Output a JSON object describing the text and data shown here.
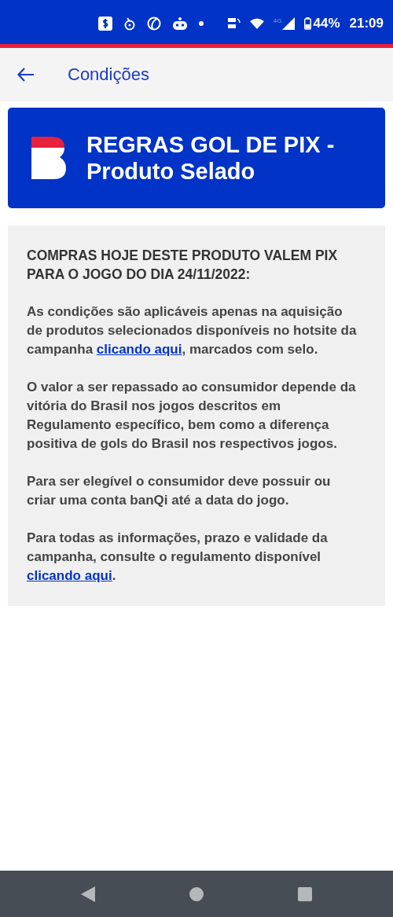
{
  "status_bar": {
    "battery": "44%",
    "time": "21:09",
    "network": "4G"
  },
  "header": {
    "title": "Condições"
  },
  "banner": {
    "title": "REGRAS GOL DE PIX - Produto Selado"
  },
  "paragraphs": [
    {
      "kind": "heading",
      "parts": [
        {
          "text": "COMPRAS HOJE DESTE PRODUTO VALEM PIX PARA O JOGO DO DIA 24/11/2022:"
        }
      ]
    },
    {
      "kind": "body",
      "parts": [
        {
          "text": "As condições são aplicáveis apenas na aquisição de produtos selecionados disponíveis no hotsite da campanha "
        },
        {
          "link": "clicando aqui"
        },
        {
          "text": ", marcados com selo."
        }
      ]
    },
    {
      "kind": "body",
      "parts": [
        {
          "text": "O valor a ser repassado ao consumidor depende da vitória do Brasil nos jogos descritos em Regulamento específico, bem como a diferença positiva de gols do Brasil nos respectivos jogos."
        }
      ]
    },
    {
      "kind": "body",
      "parts": [
        {
          "text": "Para ser elegível o consumidor deve possuir ou criar uma conta banQi até a data do jogo."
        }
      ]
    },
    {
      "kind": "body",
      "parts": [
        {
          "text": "Para todas as informações, prazo e validade da campanha, consulte o regulamento disponível "
        },
        {
          "link": "clicando aqui"
        },
        {
          "text": "."
        }
      ]
    }
  ]
}
